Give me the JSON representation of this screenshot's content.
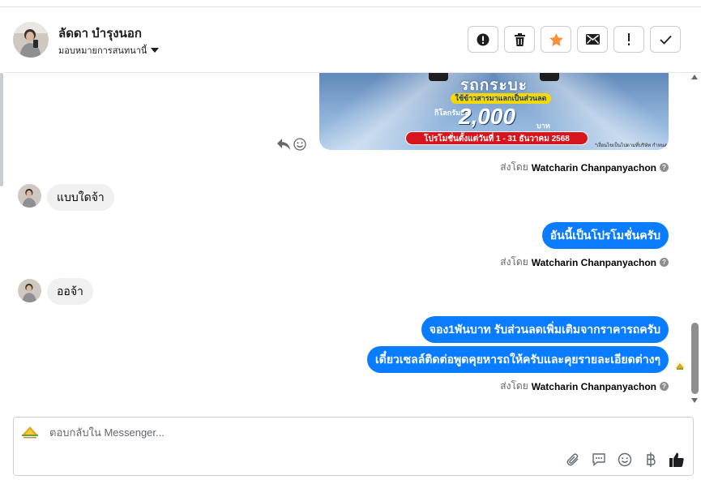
{
  "header": {
    "contact_name": "ลัดดา บำรุงนอก",
    "assign_label": "มอบหมายการสนทนานี้",
    "actions": [
      "mark-spam",
      "delete",
      "star",
      "mark-unread",
      "follow-up",
      "done"
    ]
  },
  "promo": {
    "headline": "รถกระบะ",
    "yellow_pill": "ใช้ข้าวสารมาแลกเป็นส่วนลด",
    "km_label": "กิโลกรัมละ",
    "amount": "2,000",
    "baht": "บาท",
    "red_pill": "โปรโมชั่นตั้งแต่วันที่ 1 - 31 ธันวาคม 2568",
    "fine_print": "*เงื่อนไขเป็นไปตามที่บริษัท กำหนด"
  },
  "sent_by_prefix": "ส่งโดย",
  "agent_name": "Watcharin Chanpanyachon",
  "messages": {
    "in1": "แบบใดจ้า",
    "out1": "อันนี้เป็นโปรโมชั่นครับ",
    "in2": "ออจ้า",
    "out2": "จอง1พันบาท รับส่วนลดเพิ่มเติมจากราคารถครับ",
    "out3": "เดี๋ยวเซลล์ติดต่อพูดคุยหารถให้ครับและคุยรายละเอียดต่างๆ"
  },
  "composer": {
    "placeholder": "ตอบกลับใน Messenger..."
  },
  "colors": {
    "bubble_out": "#0a7cff",
    "bubble_in": "#f0f0f0",
    "star": "#f7923b"
  }
}
